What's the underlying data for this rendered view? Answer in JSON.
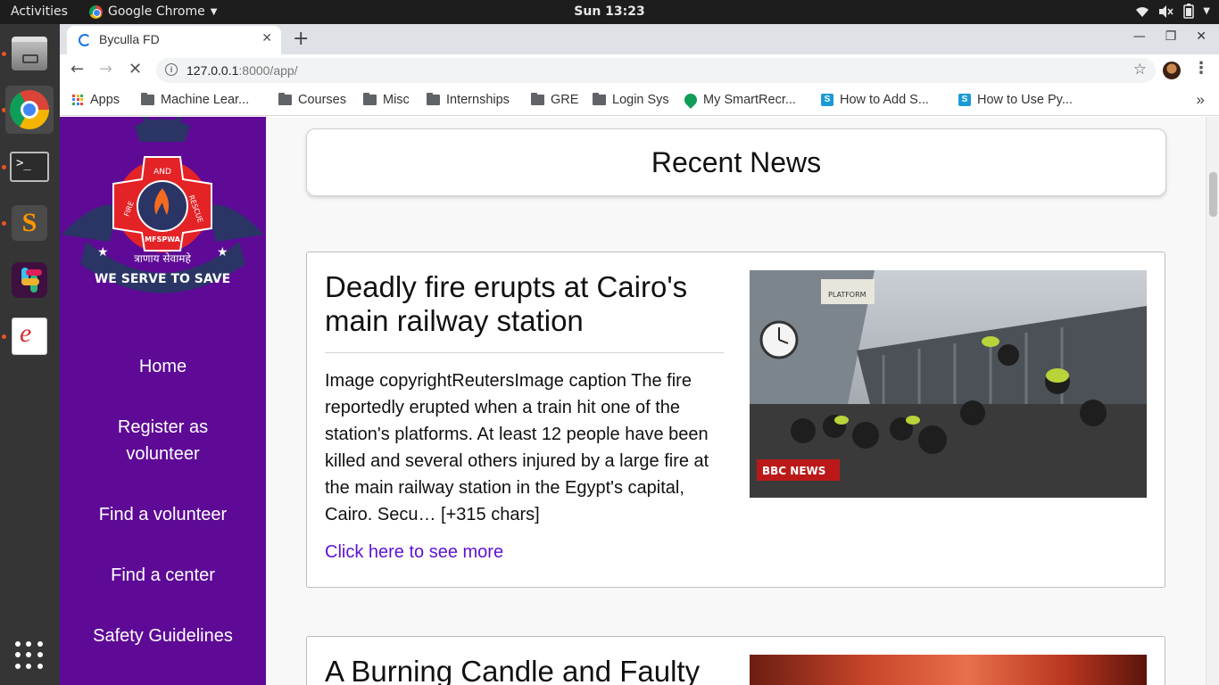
{
  "system": {
    "activities": "Activities",
    "app_name": "Google Chrome",
    "clock": "Sun 13:23"
  },
  "browser": {
    "tab_title": "Byculla FD",
    "url_host": "127.0.0.1",
    "url_rest": ":8000/app/",
    "bookmarks": [
      {
        "label": "Apps",
        "icon": "apps-icon"
      },
      {
        "label": "Machine Lear...",
        "icon": "folder-icon"
      },
      {
        "label": "Courses",
        "icon": "folder-icon"
      },
      {
        "label": "Misc",
        "icon": "folder-icon"
      },
      {
        "label": "Internships",
        "icon": "folder-icon"
      },
      {
        "label": "GRE",
        "icon": "folder-icon"
      },
      {
        "label": "Login Sys",
        "icon": "folder-icon"
      },
      {
        "label": "My SmartRecr...",
        "icon": "smartrecruiters-icon"
      },
      {
        "label": "How to Add S...",
        "icon": "site-s-icon"
      },
      {
        "label": "How to Use Py...",
        "icon": "site-s-icon"
      }
    ]
  },
  "sidebar": {
    "logo_top_text": "AND",
    "logo_left_text": "FIRE",
    "logo_right_text": "RESCUE",
    "logo_bottom_text": "MFSPWA",
    "logo_motto_hindi": "त्राणाय सेवामहे",
    "logo_motto": "WE SERVE TO SAVE",
    "nav": [
      {
        "label": "Home"
      },
      {
        "label": "Register as volunteer"
      },
      {
        "label": "Find a volunteer"
      },
      {
        "label": "Find a center"
      },
      {
        "label": "Safety Guidelines"
      }
    ]
  },
  "main": {
    "heading": "Recent News",
    "articles": [
      {
        "title": "Deadly fire erupts at Cairo's main railway station",
        "body": "Image copyrightReutersImage caption The fire reportedly erupted when a train hit one of the station's platforms. At least 12 people have been killed and several others injured by a large fire at the main railway station in the Egypt's capital, Cairo. Secu… [+315 chars]",
        "link": "Click here to see more",
        "image_badge": "BBC NEWS",
        "image_sign": "PLATFORM"
      },
      {
        "title": "A Burning Candle and Faulty"
      }
    ]
  }
}
